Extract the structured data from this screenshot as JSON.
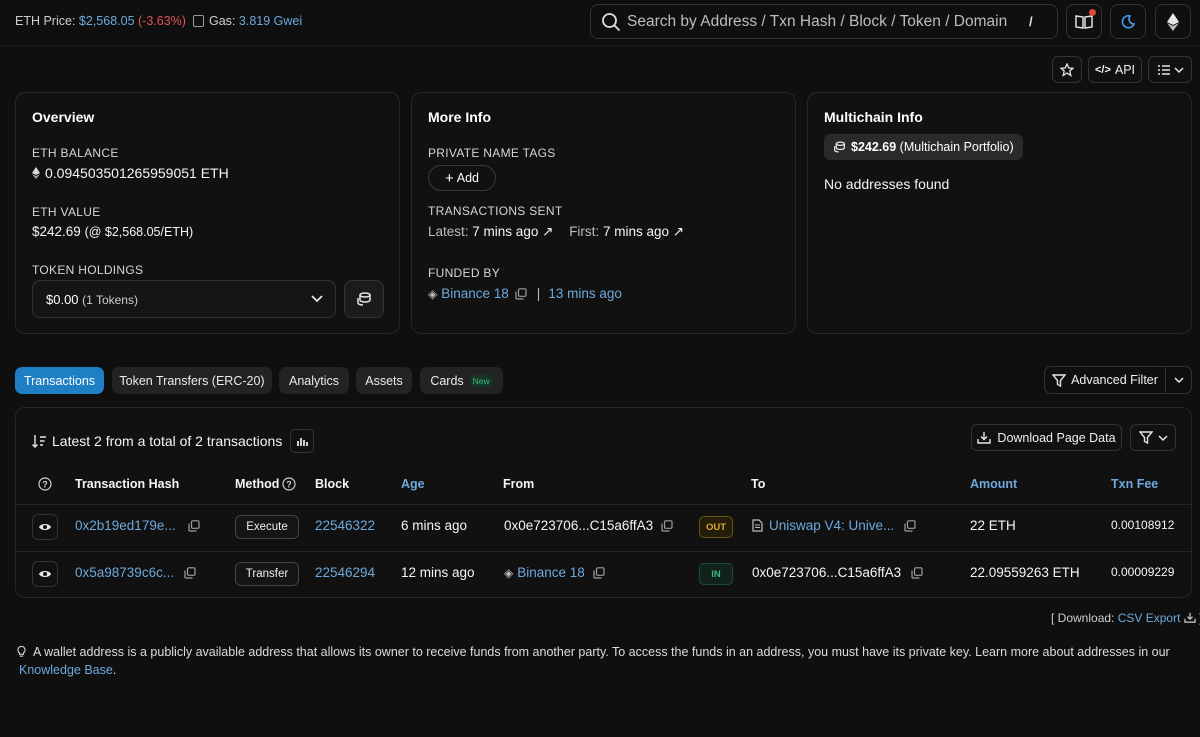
{
  "topbar": {
    "eth_price_label": "ETH Price:",
    "eth_price_value": "$2,568.05",
    "eth_price_change": "(-3.63%)",
    "gas_label": "Gas:",
    "gas_value": "3.819 Gwei",
    "search_placeholder": "Search by Address / Txn Hash / Block / Token / Domain Name",
    "search_shortcut": "/"
  },
  "toolbar": {
    "api_label": "API"
  },
  "overview": {
    "title": "Overview",
    "eth_balance_label": "ETH BALANCE",
    "eth_balance_value": "0.094503501265959051 ETH",
    "eth_value_label": "ETH VALUE",
    "eth_value_amount": "$242.69",
    "eth_value_rate": "(@ $2,568.05/ETH)",
    "token_holdings_label": "TOKEN HOLDINGS",
    "token_holdings_value": "$0.00",
    "token_holdings_count": "(1 Tokens)"
  },
  "more_info": {
    "title": "More Info",
    "private_tags_label": "PRIVATE NAME TAGS",
    "add_label": "Add",
    "tx_sent_label": "TRANSACTIONS SENT",
    "latest_label": "Latest:",
    "latest_value": "7 mins ago",
    "first_label": "First:",
    "first_value": "7 mins ago",
    "funded_by_label": "FUNDED BY",
    "funded_by_value": "Binance 18",
    "funded_sep": "|",
    "funded_time": "13 mins ago"
  },
  "multichain": {
    "title": "Multichain Info",
    "portfolio_amount": "$242.69",
    "portfolio_label": "(Multichain Portfolio)",
    "empty_text": "No addresses found"
  },
  "tabs": [
    {
      "label": "Transactions",
      "active": true
    },
    {
      "label": "Token Transfers (ERC-20)",
      "active": false
    },
    {
      "label": "Analytics",
      "active": false
    },
    {
      "label": "Assets",
      "active": false
    },
    {
      "label": "Cards",
      "active": false,
      "badge": "New"
    }
  ],
  "advanced_filter_label": "Advanced Filter",
  "transactions": {
    "summary": "Latest 2 from a total of 2 transactions",
    "download_label": "Download Page Data",
    "columns": {
      "hash": "Transaction Hash",
      "method": "Method",
      "block": "Block",
      "age": "Age",
      "from": "From",
      "to": "To",
      "amount": "Amount",
      "fee": "Txn Fee"
    },
    "rows": [
      {
        "hash": "0x2b19ed179e...",
        "method": "Execute",
        "block": "22546322",
        "age": "6 mins ago",
        "from": "0x0e723706...C15a6ffA3",
        "direction": "OUT",
        "to": "Uniswap V4: Unive...",
        "amount": "22 ETH",
        "fee": "0.00108912"
      },
      {
        "hash": "0x5a98739c6c...",
        "method": "Transfer",
        "block": "22546294",
        "age": "12 mins ago",
        "from": "Binance 18",
        "direction": "IN",
        "to": "0x0e723706...C15a6ffA3",
        "amount": "22.09559263 ETH",
        "fee": "0.00009229"
      }
    ]
  },
  "export": {
    "prefix": "[ Download:",
    "link": "CSV Export",
    "suffix": "]"
  },
  "info_note": {
    "text": "A wallet address is a publicly available address that allows its owner to receive funds from another party. To access the funds in an address, you must have its private key. Learn more about addresses in our",
    "link": "Knowledge Base",
    "end": "."
  }
}
